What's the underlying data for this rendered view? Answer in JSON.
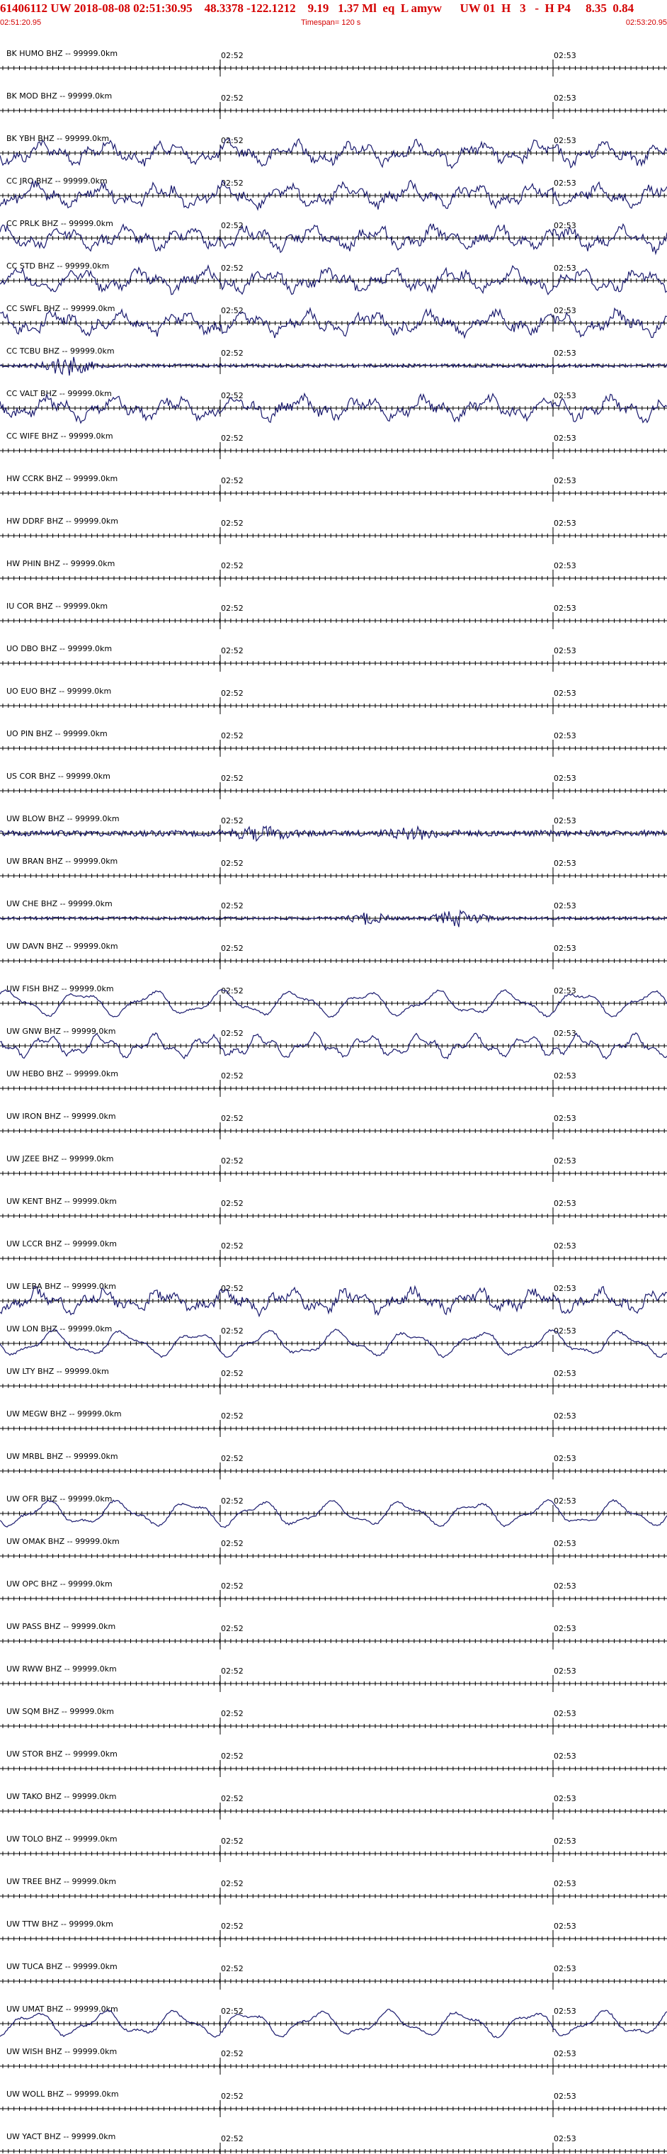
{
  "header": {
    "title": "61406112 UW 2018-08-08 02:51:30.95    48.3378 -122.1212    9.19   1.37 Ml  eq  L amyw      UW 01  H   3   -  H P4     8.35  0.84",
    "start_time": "02:51:20.95",
    "timespan": "Timespan= 120 s",
    "end_time": "02:53:20.95"
  },
  "colors": {
    "header_text": "#d40000",
    "trace": "#1a1a6e",
    "axis": "#000000",
    "label": "#000000"
  },
  "tick_labels": {
    "first": "02:52",
    "second": "02:53"
  },
  "stations": [
    {
      "label": "BK HUMO BHZ -- 99999.0km",
      "activity": "flat"
    },
    {
      "label": "BK MOD BHZ -- 99999.0km",
      "activity": "flat"
    },
    {
      "label": "BK YBH BHZ -- 99999.0km",
      "activity": "noisy"
    },
    {
      "label": "CC JRO BHZ -- 99999.0km",
      "activity": "noisy"
    },
    {
      "label": "CC PRLK BHZ -- 99999.0km",
      "activity": "noisy"
    },
    {
      "label": "CC STD BHZ -- 99999.0km",
      "activity": "noisy"
    },
    {
      "label": "CC SWFL BHZ -- 99999.0km",
      "activity": "noisy"
    },
    {
      "label": "CC TCBU BHZ -- 99999.0km",
      "activity": "event"
    },
    {
      "label": "CC VALT BHZ -- 99999.0km",
      "activity": "noisy"
    },
    {
      "label": "CC WIFE BHZ -- 99999.0km",
      "activity": "flat"
    },
    {
      "label": "HW CCRK BHZ -- 99999.0km",
      "activity": "flat"
    },
    {
      "label": "HW DDRF BHZ -- 99999.0km",
      "activity": "flat"
    },
    {
      "label": "HW PHIN BHZ -- 99999.0km",
      "activity": "flat"
    },
    {
      "label": "IU COR BHZ -- 99999.0km",
      "activity": "flat"
    },
    {
      "label": "UO DBO BHZ -- 99999.0km",
      "activity": "flat"
    },
    {
      "label": "UO EUO BHZ -- 99999.0km",
      "activity": "flat"
    },
    {
      "label": "UO PIN BHZ -- 99999.0km",
      "activity": "flat"
    },
    {
      "label": "US COR BHZ -- 99999.0km",
      "activity": "flat"
    },
    {
      "label": "UW BLOW BHZ -- 99999.0km",
      "activity": "burst"
    },
    {
      "label": "UW BRAN BHZ -- 99999.0km",
      "activity": "flat"
    },
    {
      "label": "UW CHE BHZ -- 99999.0km",
      "activity": "event2"
    },
    {
      "label": "UW DAVN BHZ -- 99999.0km",
      "activity": "flat"
    },
    {
      "label": "UW FISH BHZ -- 99999.0km",
      "activity": "swell"
    },
    {
      "label": "UW GNW BHZ -- 99999.0km",
      "activity": "swell2"
    },
    {
      "label": "UW HEBO BHZ -- 99999.0km",
      "activity": "flat"
    },
    {
      "label": "UW IRON BHZ -- 99999.0km",
      "activity": "flat"
    },
    {
      "label": "UW JZEE BHZ -- 99999.0km",
      "activity": "flat"
    },
    {
      "label": "UW KENT BHZ -- 99999.0km",
      "activity": "flat"
    },
    {
      "label": "UW LCCR BHZ -- 99999.0km",
      "activity": "flat"
    },
    {
      "label": "UW LEBA BHZ -- 99999.0km",
      "activity": "noisy"
    },
    {
      "label": "UW LON BHZ -- 99999.0km",
      "activity": "swell"
    },
    {
      "label": "UW LTY BHZ -- 99999.0km",
      "activity": "flat"
    },
    {
      "label": "UW MEGW BHZ -- 99999.0km",
      "activity": "flat"
    },
    {
      "label": "UW MRBL BHZ -- 99999.0km",
      "activity": "flat"
    },
    {
      "label": "UW OFR BHZ -- 99999.0km",
      "activity": "swell"
    },
    {
      "label": "UW OMAK BHZ -- 99999.0km",
      "activity": "flat"
    },
    {
      "label": "UW OPC BHZ -- 99999.0km",
      "activity": "flat"
    },
    {
      "label": "UW PASS BHZ -- 99999.0km",
      "activity": "flat"
    },
    {
      "label": "UW RWW BHZ -- 99999.0km",
      "activity": "flat"
    },
    {
      "label": "UW SQM BHZ -- 99999.0km",
      "activity": "flat"
    },
    {
      "label": "UW STOR BHZ -- 99999.0km",
      "activity": "flat"
    },
    {
      "label": "UW TAKO BHZ -- 99999.0km",
      "activity": "flat"
    },
    {
      "label": "UW TOLO BHZ -- 99999.0km",
      "activity": "flat"
    },
    {
      "label": "UW TREE BHZ -- 99999.0km",
      "activity": "flat"
    },
    {
      "label": "UW TTW BHZ -- 99999.0km",
      "activity": "flat"
    },
    {
      "label": "UW TUCA BHZ -- 99999.0km",
      "activity": "flat"
    },
    {
      "label": "UW UMAT BHZ -- 99999.0km",
      "activity": "swell"
    },
    {
      "label": "UW WISH BHZ -- 99999.0km",
      "activity": "flat"
    },
    {
      "label": "UW WOLL BHZ -- 99999.0km",
      "activity": "flat"
    },
    {
      "label": "UW YACT BHZ -- 99999.0km",
      "activity": "flat"
    }
  ]
}
